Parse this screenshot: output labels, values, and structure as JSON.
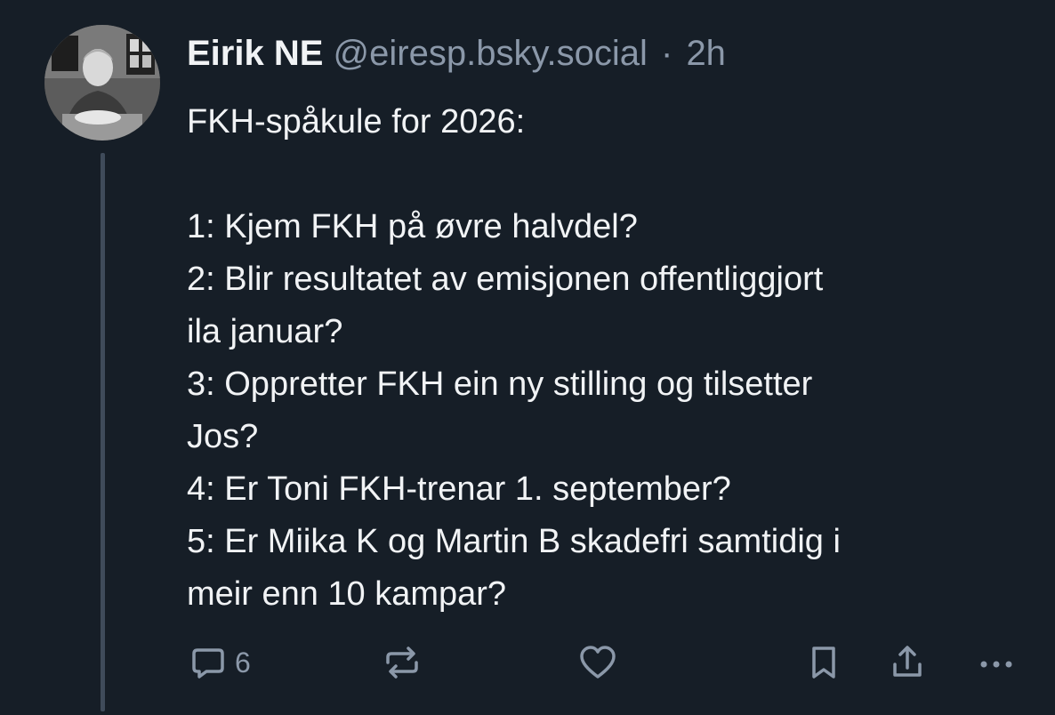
{
  "author": {
    "display_name": "Eirik NE",
    "handle": "@eiresp.bsky.social",
    "separator": "·",
    "timestamp": "2h"
  },
  "post": {
    "lines": [
      "FKH-spåkule for 2026:",
      "",
      "1: Kjem FKH på øvre halvdel?",
      "2: Blir resultatet av emisjonen offentliggjort",
      "ila januar?",
      "3: Oppretter FKH ein ny stilling og tilsetter",
      "Jos?",
      "4: Er Toni FKH-trenar 1. september?",
      "5: Er Miika K og Martin B skadefri samtidig i",
      "meir enn 10 kampar?"
    ]
  },
  "actions": {
    "reply_count": "6",
    "icons": [
      "reply-icon",
      "repost-icon",
      "like-icon",
      "bookmark-icon",
      "share-icon",
      "more-icon"
    ]
  },
  "colors": {
    "background": "#161e27",
    "text": "#f1f3f5",
    "muted": "#8b98a9",
    "thread_line": "#3f4b5a"
  }
}
